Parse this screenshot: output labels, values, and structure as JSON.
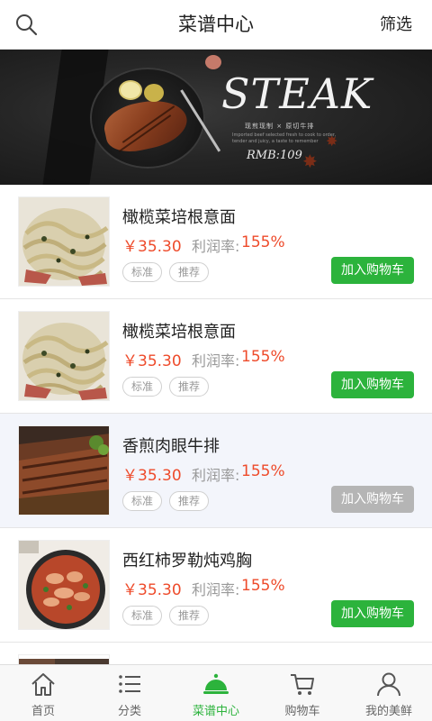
{
  "header": {
    "title": "菜谱中心",
    "filter_label": "筛选",
    "search_icon": "search-icon"
  },
  "banner": {
    "headline": "STEAK",
    "subtitle": "现煎现制 × 原切牛排",
    "fine_print": "Imported beef selected fresh to cook to order, tender and juicy, a taste to remember",
    "price": "RMB:109"
  },
  "items": [
    {
      "name": "橄榄菜培根意面",
      "price": "￥35.30",
      "profit_label": "利润率:",
      "profit_value": "155%",
      "tag1": "标准",
      "tag2": "推荐",
      "button": "加入购物车",
      "enabled": true,
      "highlighted": false,
      "image": "pasta"
    },
    {
      "name": "橄榄菜培根意面",
      "price": "￥35.30",
      "profit_label": "利润率:",
      "profit_value": "155%",
      "tag1": "标准",
      "tag2": "推荐",
      "button": "加入购物车",
      "enabled": true,
      "highlighted": false,
      "image": "pasta"
    },
    {
      "name": "香煎肉眼牛排",
      "price": "￥35.30",
      "profit_label": "利润率:",
      "profit_value": "155%",
      "tag1": "标准",
      "tag2": "推荐",
      "button": "加入购物车",
      "enabled": false,
      "highlighted": true,
      "image": "steak"
    },
    {
      "name": "西红柿罗勒炖鸡胸",
      "price": "￥35.30",
      "profit_label": "利润率:",
      "profit_value": "155%",
      "tag1": "标准",
      "tag2": "推荐",
      "button": "加入购物车",
      "enabled": true,
      "highlighted": false,
      "image": "chicken"
    }
  ],
  "tabbar": {
    "tabs": [
      {
        "label": "首页",
        "icon": "home-icon",
        "active": false
      },
      {
        "label": "分类",
        "icon": "list-icon",
        "active": false
      },
      {
        "label": "菜谱中心",
        "icon": "cloche-icon",
        "active": true
      },
      {
        "label": "购物车",
        "icon": "cart-icon",
        "active": false
      },
      {
        "label": "我的美鲜",
        "icon": "user-icon",
        "active": false
      }
    ]
  },
  "colors": {
    "accent_green": "#2cb33c",
    "price_red": "#ee4b2b",
    "disabled_gray": "#b5b5b5"
  }
}
